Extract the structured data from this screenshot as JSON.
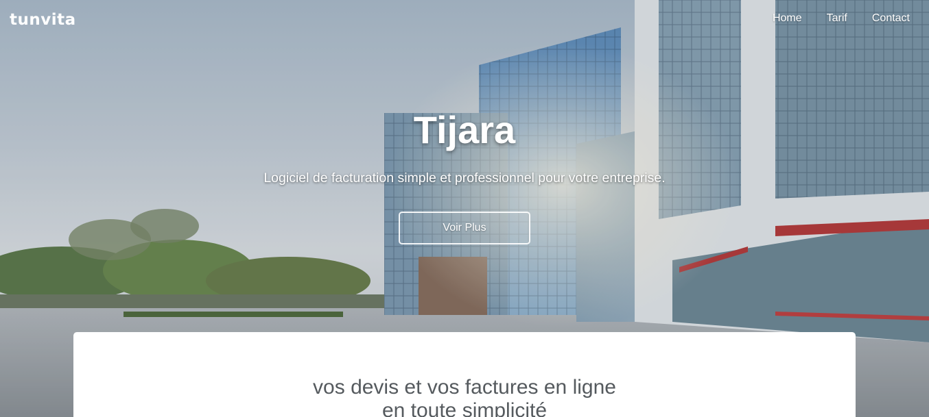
{
  "brand": {
    "logo_text": "tunvita"
  },
  "nav": {
    "items": [
      {
        "label": "Home"
      },
      {
        "label": "Tarif"
      },
      {
        "label": "Contact"
      }
    ]
  },
  "hero": {
    "title": "Tijara",
    "subtitle": "Logiciel de facturation simple et professionnel pour votre entreprise.",
    "cta_label": "Voir Plus"
  },
  "card": {
    "title_line1": "vos devis et vos factures en ligne",
    "title_line2": "en toute simplicité"
  },
  "colors": {
    "text_on_hero": "#ffffff",
    "card_background": "#ffffff",
    "card_title": "#555a5e"
  }
}
